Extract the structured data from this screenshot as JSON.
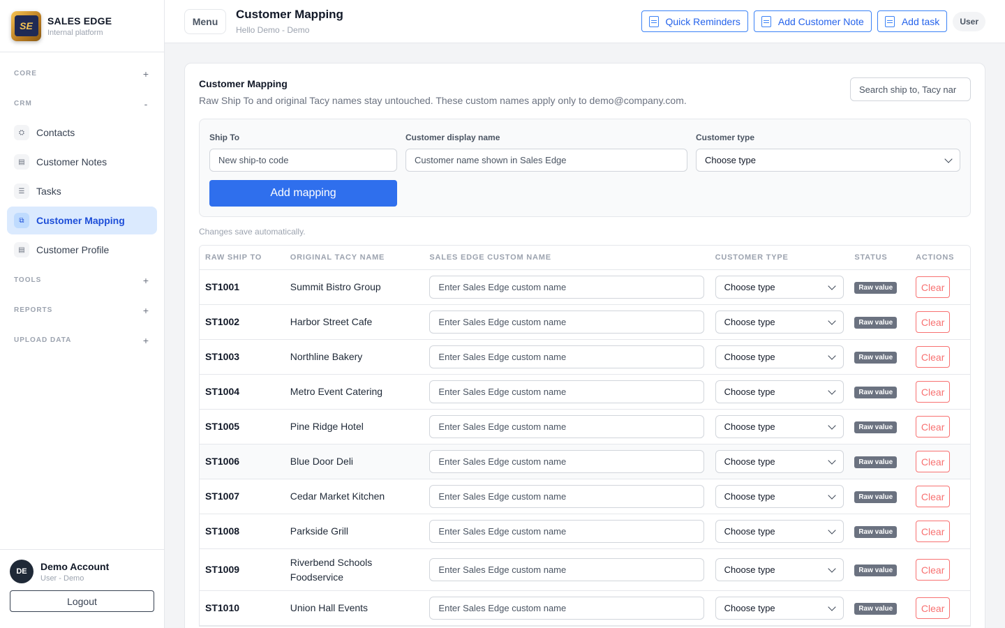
{
  "brand": {
    "title": "SALES EDGE",
    "subtitle": "Internal platform",
    "logo_text": "SE"
  },
  "sidebar": {
    "sections": [
      {
        "label": "CORE",
        "toggle": "+"
      },
      {
        "label": "CRM",
        "toggle": "-"
      },
      {
        "label": "TOOLS",
        "toggle": "+"
      },
      {
        "label": "REPORTS",
        "toggle": "+"
      },
      {
        "label": "UPLOAD DATA",
        "toggle": "+"
      }
    ],
    "items": [
      {
        "label": "Contacts",
        "icon": "contacts-icon",
        "glyph": "⛭"
      },
      {
        "label": "Customer Notes",
        "icon": "note-icon",
        "glyph": "▤"
      },
      {
        "label": "Tasks",
        "icon": "tasks-icon",
        "glyph": "☰"
      },
      {
        "label": "Customer Mapping",
        "icon": "mapping-icon",
        "glyph": "⧉",
        "active": true
      },
      {
        "label": "Customer Profile",
        "icon": "profile-icon",
        "glyph": "▤"
      }
    ]
  },
  "account": {
    "initials": "DE",
    "name": "Demo Account",
    "role": "User - Demo",
    "logout_label": "Logout"
  },
  "header": {
    "menu_label": "Menu",
    "title": "Customer Mapping",
    "subtitle": "Hello Demo - Demo",
    "actions": [
      {
        "label": "Quick Reminders",
        "icon": "reminder-icon"
      },
      {
        "label": "Add Customer Note",
        "icon": "note-icon"
      },
      {
        "label": "Add task",
        "icon": "task-icon"
      }
    ],
    "user_chip": "User"
  },
  "main": {
    "title": "Customer Mapping",
    "description": "Raw Ship To and original Tacy names stay untouched. These custom names apply only to demo@company.com.",
    "search_placeholder": "Search ship to, Tacy nar",
    "form": {
      "ship_to_label": "Ship To",
      "ship_to_placeholder": "New ship-to code",
      "display_label": "Customer display name",
      "display_placeholder": "Customer name shown in Sales Edge",
      "type_label": "Customer type",
      "type_value": "Choose type",
      "add_label": "Add mapping"
    },
    "autosave": "Changes save automatically.",
    "columns": [
      "RAW SHIP TO",
      "ORIGINAL TACY NAME",
      "SALES EDGE CUSTOM NAME",
      "CUSTOMER TYPE",
      "STATUS",
      "ACTIONS"
    ],
    "row_placeholder": "Enter Sales Edge custom name",
    "row_type": "Choose type",
    "row_status": "Raw value",
    "row_action": "Clear",
    "rows": [
      {
        "code": "ST1001",
        "name": "Summit Bistro Group"
      },
      {
        "code": "ST1002",
        "name": "Harbor Street Cafe"
      },
      {
        "code": "ST1003",
        "name": "Northline Bakery"
      },
      {
        "code": "ST1004",
        "name": "Metro Event Catering"
      },
      {
        "code": "ST1005",
        "name": "Pine Ridge Hotel"
      },
      {
        "code": "ST1006",
        "name": "Blue Door Deli"
      },
      {
        "code": "ST1007",
        "name": "Cedar Market Kitchen"
      },
      {
        "code": "ST1008",
        "name": "Parkside Grill"
      },
      {
        "code": "ST1009",
        "name": "Riverbend Schools Foodservice"
      },
      {
        "code": "ST1010",
        "name": "Union Hall Events"
      }
    ]
  }
}
